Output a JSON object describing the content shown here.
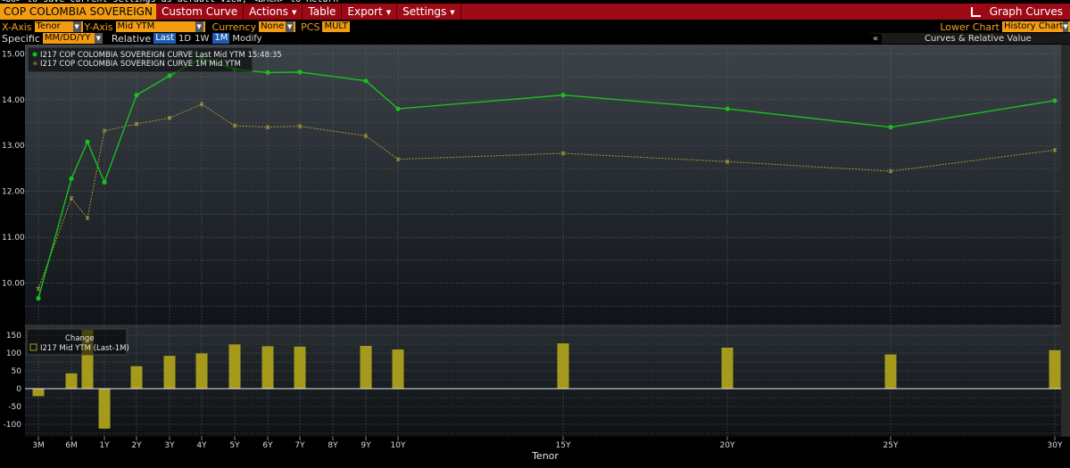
{
  "top_hint": "<GO> to save current settings as default view, <BACK> to Return",
  "menu": {
    "ticker": "COP COLOMBIA SOVEREIGN",
    "custom_curve": "Custom Curve",
    "actions": "Actions",
    "table": "Table",
    "export": "Export",
    "settings": "Settings",
    "graph_curves": "Graph Curves"
  },
  "controls": {
    "x_axis_label": "X-Axis",
    "x_axis_value": "Tenor",
    "y_axis_label": "Y-Axis",
    "y_axis_value": "Mid YTM",
    "currency_label": "Currency",
    "currency_value": "None",
    "pcs_label": "PCS",
    "pcs_value": "MULT",
    "lower_chart_label": "Lower Chart",
    "lower_chart_value": "History Chart",
    "specific_label": "Specific",
    "date_placeholder": "MM/DD/YY",
    "relative_label": "Relative",
    "btn_last": "Last",
    "btn_1d": "1D",
    "btn_1w": "1W",
    "btn_1m": "1M",
    "modify": "Modify",
    "collapse": "«",
    "panel_title": "Curves & Relative Value"
  },
  "colors": {
    "menubar": "#9d0a16",
    "accent": "#f39c12",
    "series_last": "#19c01c",
    "series_1m": "#a8963a",
    "bars": "#a69a1c"
  },
  "chart_data": [
    {
      "type": "line",
      "x_categories": [
        "3M",
        "6M",
        "9M",
        "1Y",
        "2Y",
        "3Y",
        "4Y",
        "5Y",
        "6Y",
        "7Y",
        "8Y",
        "9Y",
        "10Y",
        "15Y",
        "20Y",
        "25Y",
        "30Y"
      ],
      "tick_labels": [
        "3M",
        "6M",
        "1Y",
        "2Y",
        "3Y",
        "4Y",
        "5Y",
        "6Y",
        "7Y",
        "8Y",
        "9Y",
        "10Y",
        "15Y",
        "20Y",
        "25Y",
        "30Y"
      ],
      "ylim": [
        9.1,
        15.2
      ],
      "y_ticks": [
        "10.00",
        "11.00",
        "12.00",
        "13.00",
        "14.00",
        "15.00"
      ],
      "grid": true,
      "legend": "top-left",
      "series": [
        {
          "name": "I217 COP COLOMBIA SOVEREIGN CURVE Last Mid YTM 15:48:35",
          "points": [
            {
              "x": "3M",
              "y": 9.67
            },
            {
              "x": "6M",
              "y": 12.28
            },
            {
              "x": "9M",
              "y": 13.08
            },
            {
              "x": "1Y",
              "y": 12.2
            },
            {
              "x": "2Y",
              "y": 14.1
            },
            {
              "x": "3Y",
              "y": 14.52
            },
            {
              "x": "4Y",
              "y": 14.9
            },
            {
              "x": "5Y",
              "y": 14.66
            },
            {
              "x": "6Y",
              "y": 14.59
            },
            {
              "x": "7Y",
              "y": 14.6
            },
            {
              "x": "9Y",
              "y": 14.41
            },
            {
              "x": "10Y",
              "y": 13.8
            },
            {
              "x": "15Y",
              "y": 14.1
            },
            {
              "x": "20Y",
              "y": 13.8
            },
            {
              "x": "25Y",
              "y": 13.4
            },
            {
              "x": "30Y",
              "y": 13.98
            }
          ]
        },
        {
          "name": "I217 COP COLOMBIA SOVEREIGN CURVE 1M Mid YTM",
          "points": [
            {
              "x": "3M",
              "y": 9.88
            },
            {
              "x": "6M",
              "y": 11.85
            },
            {
              "x": "9M",
              "y": 11.42
            },
            {
              "x": "1Y",
              "y": 13.32
            },
            {
              "x": "2Y",
              "y": 13.47
            },
            {
              "x": "3Y",
              "y": 13.6
            },
            {
              "x": "4Y",
              "y": 13.9
            },
            {
              "x": "5Y",
              "y": 13.43
            },
            {
              "x": "6Y",
              "y": 13.4
            },
            {
              "x": "7Y",
              "y": 13.42
            },
            {
              "x": "9Y",
              "y": 13.21
            },
            {
              "x": "10Y",
              "y": 12.7
            },
            {
              "x": "15Y",
              "y": 12.83
            },
            {
              "x": "20Y",
              "y": 12.65
            },
            {
              "x": "25Y",
              "y": 12.44
            },
            {
              "x": "30Y",
              "y": 12.9
            }
          ]
        }
      ]
    },
    {
      "type": "bar",
      "title": "Change",
      "xlabel": "Tenor",
      "ylim": [
        -135,
        175
      ],
      "y_ticks": [
        -100,
        -50,
        0,
        50,
        100,
        150
      ],
      "y_tick_labels": [
        "-100",
        "-50",
        "0",
        "50",
        "100",
        "150"
      ],
      "grid": true,
      "legend": "top-left",
      "series": [
        {
          "name": "I217 Mid YTM (Last-1M)",
          "points": [
            {
              "x": "3M",
              "y": -21
            },
            {
              "x": "6M",
              "y": 43
            },
            {
              "x": "9M",
              "y": 165
            },
            {
              "x": "1Y",
              "y": -112
            },
            {
              "x": "2Y",
              "y": 63
            },
            {
              "x": "3Y",
              "y": 92
            },
            {
              "x": "4Y",
              "y": 99
            },
            {
              "x": "5Y",
              "y": 124
            },
            {
              "x": "6Y",
              "y": 119
            },
            {
              "x": "7Y",
              "y": 118
            },
            {
              "x": "9Y",
              "y": 120
            },
            {
              "x": "10Y",
              "y": 110
            },
            {
              "x": "15Y",
              "y": 127
            },
            {
              "x": "20Y",
              "y": 115
            },
            {
              "x": "25Y",
              "y": 96
            },
            {
              "x": "30Y",
              "y": 108
            }
          ]
        }
      ]
    }
  ]
}
